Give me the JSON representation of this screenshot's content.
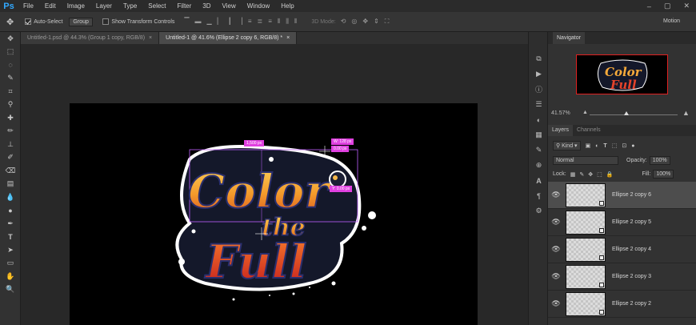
{
  "app": {
    "logo": "Ps"
  },
  "menu": [
    "File",
    "Edit",
    "Image",
    "Layer",
    "Type",
    "Select",
    "Filter",
    "3D",
    "View",
    "Window",
    "Help"
  ],
  "window_controls": [
    "–",
    "▢",
    "✕"
  ],
  "options": {
    "auto_select_label": "Auto-Select",
    "auto_select_checked": true,
    "group_value": "Group",
    "transform_label": "Show Transform Controls",
    "mode_3d": "3D Mode:",
    "workspace": "Motion"
  },
  "tabs": [
    {
      "label": "Untitled-1.psd @ 44.3% (Group 1 copy, RGB/8)",
      "close": "×",
      "active": false
    },
    {
      "label": "Untitled-1 @ 41.6% (Ellipse 2 copy 6, RGB/8) *",
      "close": "×",
      "active": true
    }
  ],
  "tools": [
    "move-icon",
    "marquee-icon",
    "lasso-icon",
    "quick-select-icon",
    "crop-icon",
    "eyedropper-icon",
    "healing-icon",
    "brush-icon",
    "stamp-icon",
    "history-brush-icon",
    "eraser-icon",
    "gradient-icon",
    "blur-icon",
    "dodge-icon",
    "pen-icon",
    "type-icon",
    "path-select-icon",
    "shape-icon",
    "hand-icon",
    "zoom-icon"
  ],
  "canvas": {
    "artwork_line1": "Color",
    "artwork_line2": "the",
    "artwork_line3": "Full",
    "measure_labels": [
      "1,500 px",
      "W: 128 px",
      "0.00 px",
      "Y: 0.00 px"
    ]
  },
  "navigator": {
    "title": "Navigator",
    "zoom": "41.57%",
    "thumb_line1": "Color",
    "thumb_line2": "Full"
  },
  "layers": {
    "tab_layers": "Layers",
    "tab_channels": "Channels",
    "kind": "Kind",
    "blend_mode": "Normal",
    "opacity_label": "Opacity:",
    "opacity_value": "100%",
    "lock_label": "Lock:",
    "fill_label": "Fill:",
    "fill_value": "100%",
    "items": [
      {
        "name": "Ellipse 2 copy 6",
        "selected": true
      },
      {
        "name": "Ellipse 2 copy 5",
        "selected": false
      },
      {
        "name": "Ellipse 2 copy 4",
        "selected": false
      },
      {
        "name": "Ellipse 2 copy 3",
        "selected": false
      },
      {
        "name": "Ellipse 2 copy 2",
        "selected": false
      }
    ]
  }
}
